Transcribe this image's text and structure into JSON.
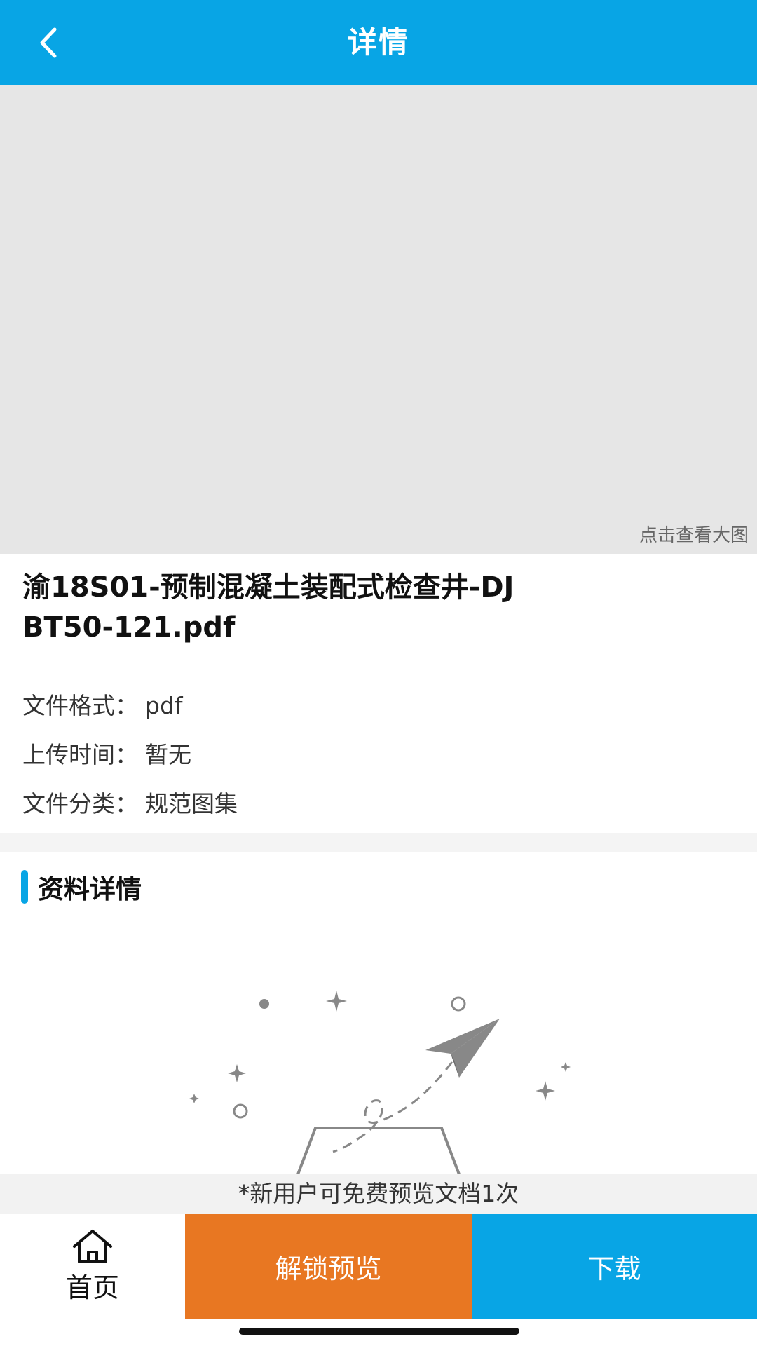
{
  "header": {
    "title": "详情",
    "back_icon": "chevron-left-icon",
    "background": "#08a5e5"
  },
  "preview": {
    "hint": "点击查看大图"
  },
  "document": {
    "title": "渝18S01-预制混凝土装配式检查井-DJBT50-121.pdf",
    "meta": [
      {
        "label": "文件格式：",
        "value": "pdf"
      },
      {
        "label": "上传时间：",
        "value": "暂无"
      },
      {
        "label": "文件分类：",
        "value": "规范图集"
      }
    ]
  },
  "section": {
    "title": "资料详情",
    "accent": "#08a5e5",
    "illustration_icon": "paper-plane-empty-state-icon"
  },
  "notice": "*新用户可免费预览文档1次",
  "bottom_bar": {
    "home_label": "首页",
    "home_icon": "home-icon",
    "unlock_label": "解锁预览",
    "unlock_color": "#e87722",
    "download_label": "下载",
    "download_color": "#08a5e5"
  }
}
